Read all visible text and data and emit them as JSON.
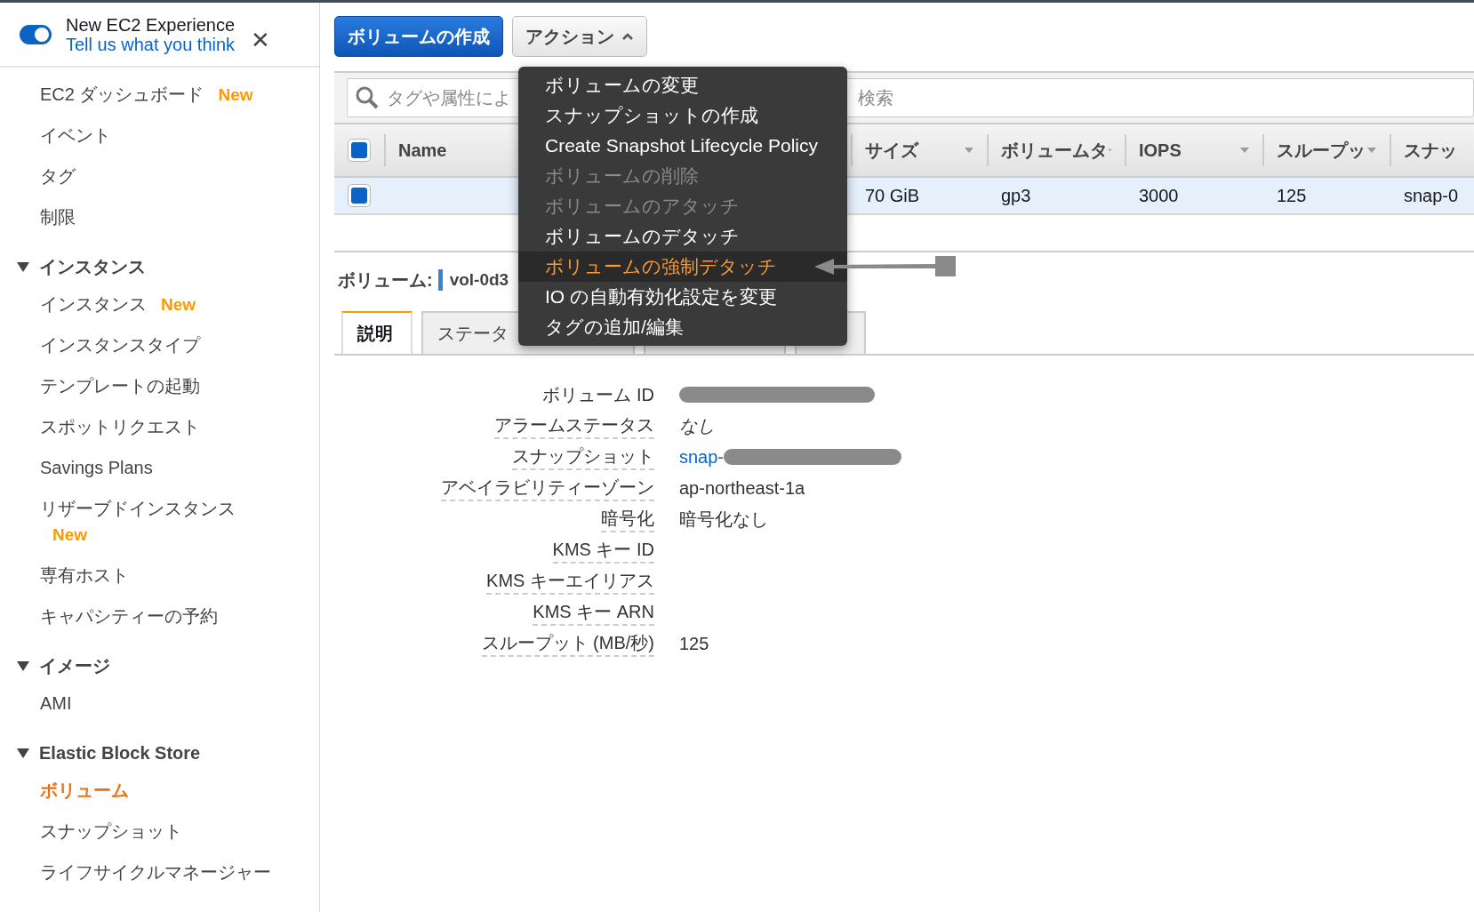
{
  "experience": {
    "on": true,
    "title": "New EC2 Experience",
    "link": "Tell us what you think",
    "close": "✕"
  },
  "sidebar": {
    "items": [
      {
        "label": "EC2 ダッシュボード",
        "badge": "New",
        "selected": false
      },
      {
        "label": "イベント",
        "selected": false
      },
      {
        "label": "タグ",
        "selected": false
      },
      {
        "label": "制限",
        "selected": false
      }
    ],
    "sections": [
      {
        "title": "インスタンス",
        "expanded": true,
        "items": [
          {
            "label": "インスタンス",
            "badge": "New",
            "selected": false
          },
          {
            "label": "インスタンスタイプ",
            "selected": false
          },
          {
            "label": "テンプレートの起動",
            "selected": false
          },
          {
            "label": "スポットリクエスト",
            "selected": false
          },
          {
            "label": "Savings Plans",
            "selected": false
          },
          {
            "label": "リザーブドインスタンス",
            "badge": "New",
            "badge_below": true,
            "selected": false
          },
          {
            "label": "専有ホスト",
            "selected": false
          },
          {
            "label": "キャパシティーの予約",
            "selected": false
          }
        ]
      },
      {
        "title": "イメージ",
        "expanded": true,
        "items": [
          {
            "label": "AMI",
            "selected": false
          }
        ]
      },
      {
        "title": "Elastic Block Store",
        "expanded": true,
        "items": [
          {
            "label": "ボリューム",
            "selected": true
          },
          {
            "label": "スナップショット",
            "selected": false
          },
          {
            "label": "ライフサイクルマネージャー",
            "selected": false
          }
        ]
      }
    ]
  },
  "toolbar": {
    "create": "ボリュームの作成",
    "actions": "アクション",
    "actions_open": true
  },
  "search": {
    "hint_start": "タグや属性によ",
    "hint_end": "検索"
  },
  "table": {
    "all_checked": true,
    "columns": [
      "Name",
      "サイズ",
      "ボリュームタ",
      "IOPS",
      "スループッ",
      "スナッ"
    ],
    "rows": [
      {
        "checked": true,
        "selected": true,
        "cells": [
          "",
          "70 GiB",
          "gp3",
          "3000",
          "125",
          "snap-0"
        ]
      }
    ]
  },
  "detail": {
    "label": "ボリューム:",
    "volume": "vol-0d3"
  },
  "tabs": [
    {
      "label": "説明",
      "selected": true
    },
    {
      "label": "ステータ",
      "selected": false
    },
    {
      "selected": false
    },
    {
      "selected": false
    }
  ],
  "fields": [
    {
      "label": "ボリューム ID",
      "redacted": true,
      "underlined": false,
      "kind": "text"
    },
    {
      "label": "アラームステータス",
      "value": "なし",
      "redacted": false,
      "underlined": true,
      "kind": "italic"
    },
    {
      "label": "スナップショット",
      "value": "snap-",
      "redacted": true,
      "underlined": true,
      "kind": "link"
    },
    {
      "label": "アベイラビリティーゾーン",
      "value": "ap-northeast-1a",
      "redacted": false,
      "underlined": true,
      "kind": "text"
    },
    {
      "label": "暗号化",
      "value": "暗号化なし",
      "redacted": false,
      "underlined": true,
      "kind": "text"
    },
    {
      "label": "KMS キー ID",
      "redacted": false,
      "underlined": true
    },
    {
      "label": "KMS キーエイリアス",
      "redacted": false,
      "underlined": true
    },
    {
      "label": "KMS キー ARN",
      "redacted": false,
      "underlined": true
    },
    {
      "label": "スループット (MB/秒)",
      "value": "125",
      "redacted": false,
      "underlined": true,
      "kind": "text"
    }
  ],
  "menu": [
    {
      "label": "ボリュームの変更",
      "disabled": false,
      "selected": false
    },
    {
      "label": "スナップショットの作成",
      "disabled": false,
      "selected": false
    },
    {
      "label": "Create Snapshot Lifecycle Policy",
      "disabled": false,
      "selected": false
    },
    {
      "label": "ボリュームの削除",
      "disabled": true,
      "selected": false
    },
    {
      "label": "ボリュームのアタッチ",
      "disabled": true,
      "selected": false
    },
    {
      "label": "ボリュームのデタッチ",
      "disabled": false,
      "selected": false
    },
    {
      "label": "ボリュームの強制デタッチ",
      "disabled": false,
      "selected": true
    },
    {
      "label": "IO の自動有効化設定を変更",
      "disabled": false,
      "selected": false
    },
    {
      "label": "タグの追加/編集",
      "disabled": false,
      "selected": false
    }
  ]
}
